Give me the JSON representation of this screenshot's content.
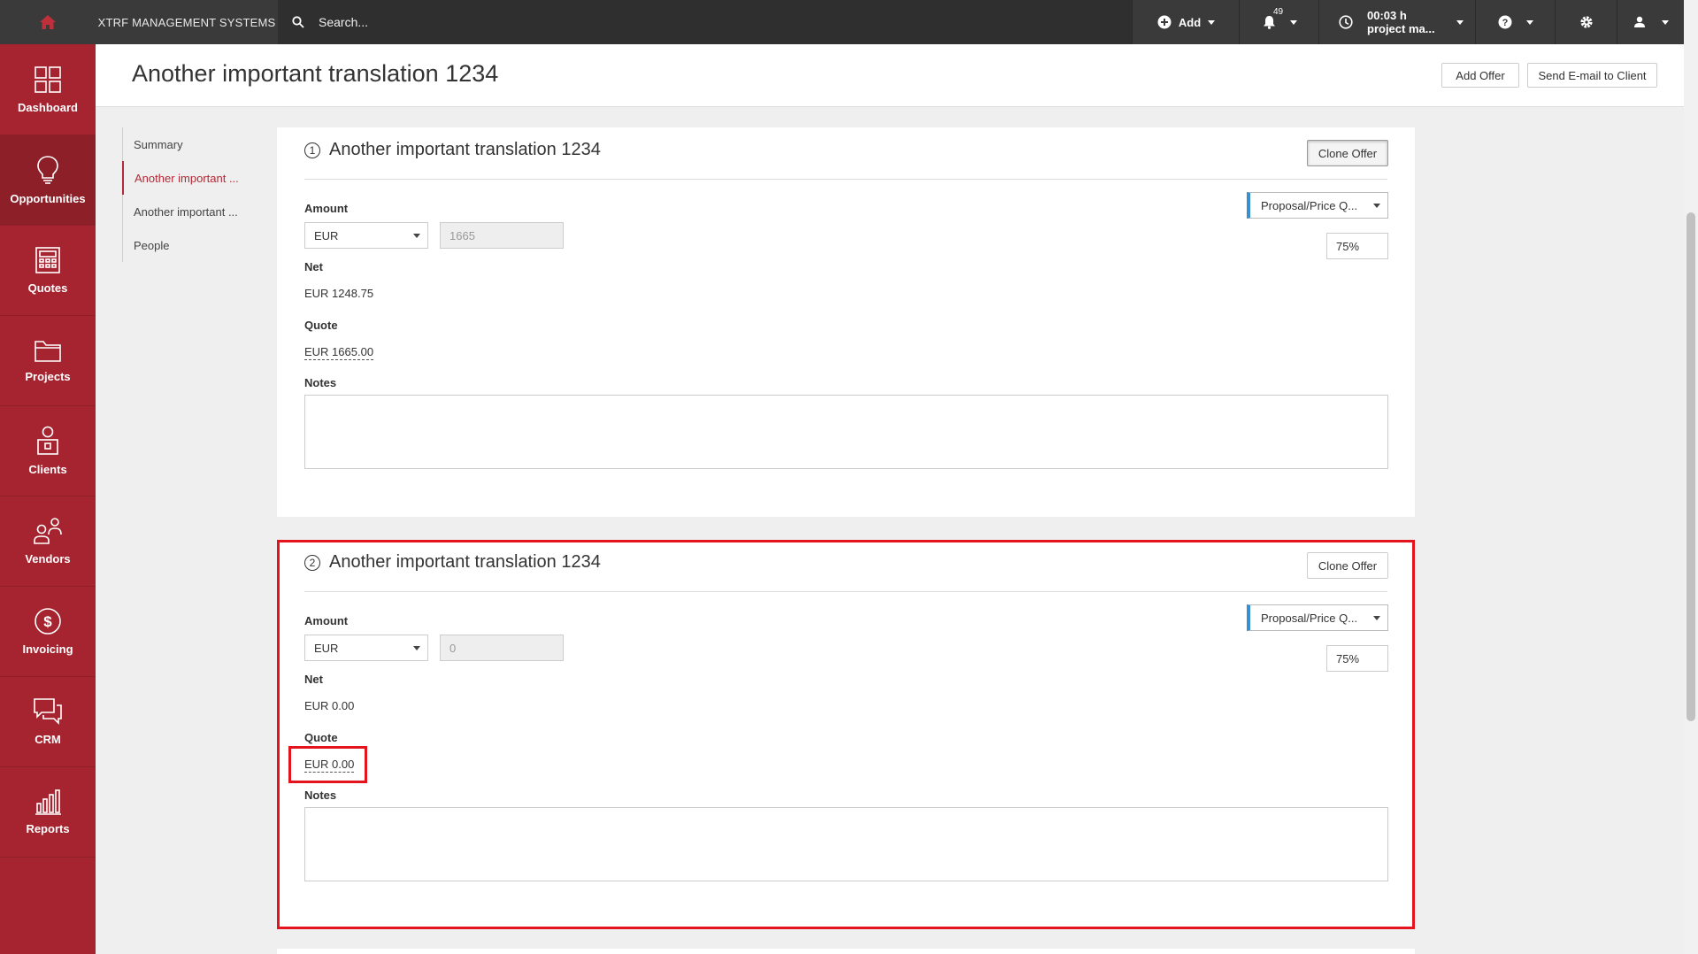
{
  "topbar": {
    "brand": "XTRF MANAGEMENT SYSTEMS",
    "search_placeholder": "Search...",
    "add_label": "Add",
    "notifications_count": "49",
    "timer_time": "00:03 h",
    "timer_task": "project ma..."
  },
  "sidebar": {
    "items": [
      {
        "label": "Dashboard",
        "icon": "dashboard-icon"
      },
      {
        "label": "Opportunities",
        "icon": "lightbulb-icon"
      },
      {
        "label": "Quotes",
        "icon": "calculator-icon"
      },
      {
        "label": "Projects",
        "icon": "folder-icon"
      },
      {
        "label": "Clients",
        "icon": "client-icon"
      },
      {
        "label": "Vendors",
        "icon": "vendors-icon"
      },
      {
        "label": "Invoicing",
        "icon": "dollar-icon"
      },
      {
        "label": "CRM",
        "icon": "chat-icon"
      },
      {
        "label": "Reports",
        "icon": "bar-chart-icon"
      }
    ]
  },
  "header": {
    "title": "Another important translation 1234",
    "add_offer": "Add Offer",
    "send_email": "Send E-mail to Client"
  },
  "subnav": {
    "items": [
      "Summary",
      "Another important ...",
      "Another important ...",
      "People"
    ]
  },
  "offers": [
    {
      "number": "1",
      "title": "Another important translation 1234",
      "clone_label": "Clone Offer",
      "amount_label": "Amount",
      "currency": "EUR",
      "amount_value": "1665",
      "status": "Proposal/Price Q...",
      "probability": "75%",
      "net_label": "Net",
      "net_value": "EUR 1248.75",
      "quote_label": "Quote",
      "quote_value": "EUR 1665.00",
      "notes_label": "Notes"
    },
    {
      "number": "2",
      "title": "Another important translation 1234",
      "clone_label": "Clone Offer",
      "amount_label": "Amount",
      "currency": "EUR",
      "amount_value": "0",
      "status": "Proposal/Price Q...",
      "probability": "75%",
      "net_label": "Net",
      "net_value": "EUR 0.00",
      "quote_label": "Quote",
      "quote_value": "EUR 0.00",
      "notes_label": "Notes"
    }
  ],
  "colors": {
    "sidebar": "#a6242f",
    "sidebar_active": "#8c1f28",
    "topbar": "#3a3a3a",
    "highlight": "#e3141e",
    "status_accent": "#3a8fd0"
  }
}
